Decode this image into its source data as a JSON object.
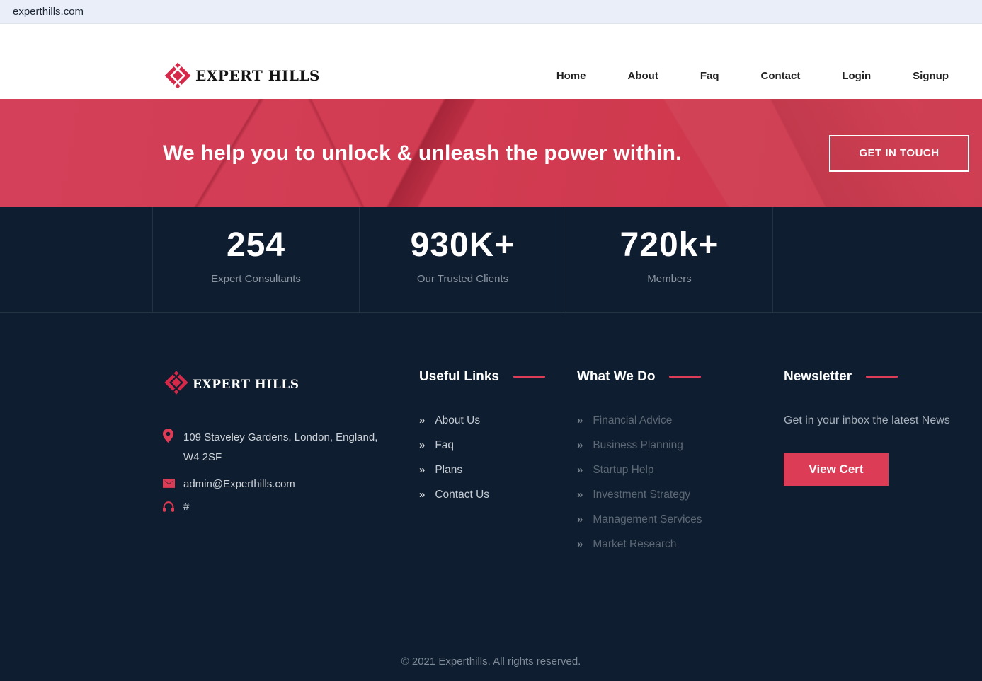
{
  "browser": {
    "url": "experthills.com"
  },
  "header": {
    "brand": "EXPERT HILLS",
    "nav": [
      "Home",
      "About",
      "Faq",
      "Contact",
      "Login",
      "Signup"
    ]
  },
  "hero": {
    "headline": "We help you to unlock & unleash the power within.",
    "cta_label": "GET IN TOUCH"
  },
  "stats": [
    {
      "value": "254",
      "label": "Expert Consultants"
    },
    {
      "value": "930K+",
      "label": "Our Trusted Clients"
    },
    {
      "value": "720k+",
      "label": "Members"
    }
  ],
  "footer": {
    "brand": "EXPERT HILLS",
    "contact": {
      "address_line1": "109 Staveley Gardens, London, England,",
      "address_line2": "W4 2SF",
      "email": "admin@Experthills.com",
      "phone": "#"
    },
    "useful_links": {
      "title": "Useful Links",
      "items": [
        "About Us",
        "Faq",
        "Plans",
        "Contact Us"
      ]
    },
    "what_we_do": {
      "title": "What We Do",
      "items": [
        "Financial Advice",
        "Business Planning",
        "Startup Help",
        "Investment Strategy",
        "Management Services",
        "Market Research"
      ]
    },
    "newsletter": {
      "title": "Newsletter",
      "text": "Get in your inbox the latest News",
      "button_label": "View Cert"
    },
    "copyright": "© 2021 Experthills. All rights reserved."
  },
  "icons": {
    "double_chevron": "»",
    "contact_icons": [
      "location-pin",
      "envelope",
      "headphones"
    ]
  },
  "colors": {
    "accent": "#dc3c55",
    "hero_red": "#d23c52",
    "dark_navy": "#0e1d2f",
    "topbar": "#e9eef8"
  }
}
